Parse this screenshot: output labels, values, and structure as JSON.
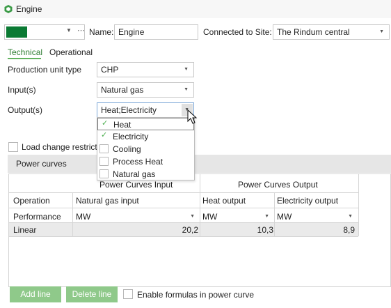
{
  "window": {
    "title": "Engine"
  },
  "header": {
    "color_value": "#0a7a33",
    "name_label": "Name:",
    "name_value": "Engine",
    "site_label": "Connected to Site:",
    "site_value": "The Rindum central"
  },
  "tabs": [
    {
      "label": "Technical",
      "active": true
    },
    {
      "label": "Operational",
      "active": false
    }
  ],
  "form": {
    "production_unit_type_label": "Production unit type",
    "production_unit_type_value": "CHP",
    "inputs_label": "Input(s)",
    "inputs_value": "Natural gas",
    "outputs_label": "Output(s)",
    "outputs_value": "Heat;Electricity",
    "load_change_label": "Load change restrict"
  },
  "outputs_dropdown": {
    "options": [
      {
        "label": "Heat",
        "checked": true
      },
      {
        "label": "Electricity",
        "checked": true
      },
      {
        "label": "Cooling",
        "checked": false
      },
      {
        "label": "Process Heat",
        "checked": false
      },
      {
        "label": "Natural gas",
        "checked": false
      }
    ]
  },
  "power_curves": {
    "title": "Power curves",
    "group_input": "Power Curves Input",
    "group_output": "Power Curves Output",
    "columns": [
      "Operation",
      "Natural gas input",
      "Heat output",
      "Electricity output"
    ],
    "unit_row": {
      "label": "Performance",
      "units": [
        "MW",
        "MW",
        "MW"
      ]
    },
    "rows": [
      {
        "operation": "Linear",
        "natural_gas_input": "20,2",
        "heat_output": "10,3",
        "electricity_output": "8,9"
      }
    ]
  },
  "footer": {
    "add_line": "Add line",
    "delete_line": "Delete line",
    "enable_formulas": "Enable formulas in power curve"
  },
  "colors": {
    "accent": "#62b35f",
    "button": "#8fc98a",
    "dark_green": "#0a7a33"
  }
}
